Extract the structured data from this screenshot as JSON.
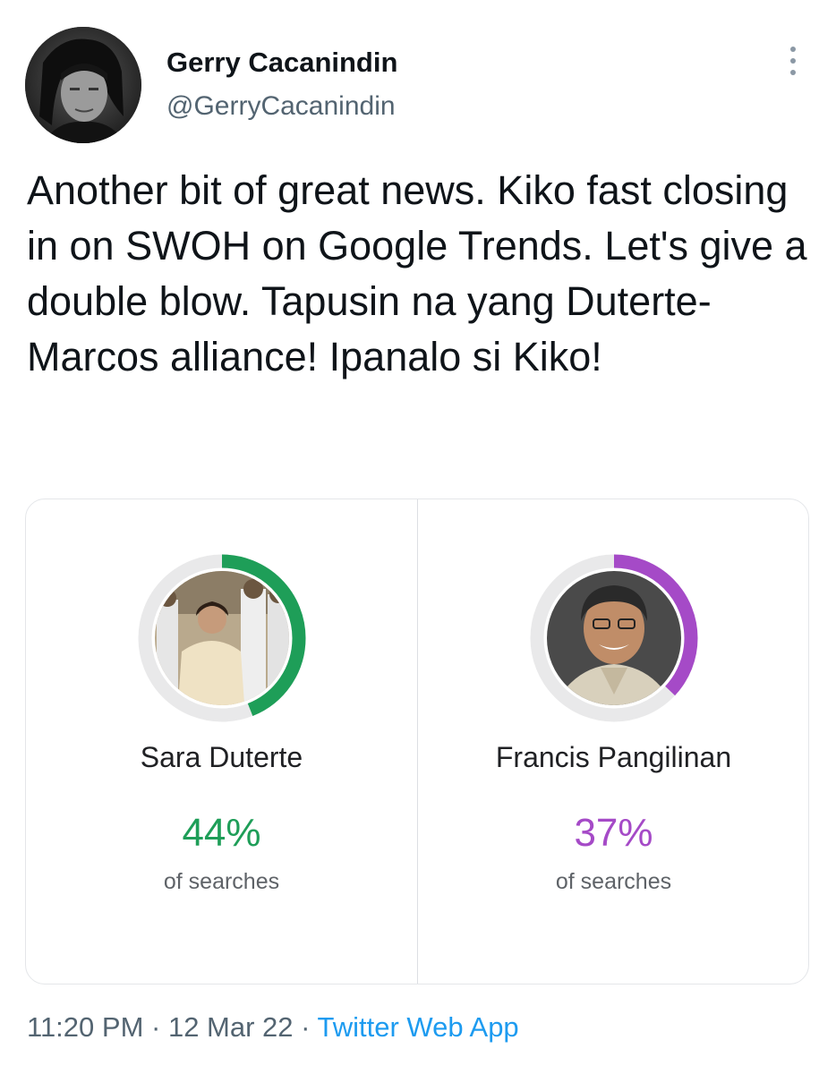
{
  "tweet": {
    "author": {
      "name": "Gerry Cacanindin",
      "handle": "@GerryCacanindin"
    },
    "text": "Another bit of great news. Kiko fast closing in on SWOH on Google Trends. Let's give a double blow. Tapusin na yang Duterte-Marcos alliance! Ipanalo si Kiko!",
    "time": "11:20 PM",
    "separator": " · ",
    "date": "12 Mar 22",
    "source": "Twitter Web App"
  },
  "card": {
    "left": {
      "name": "Sara Duterte",
      "percent_label": "44%",
      "share": 0.44,
      "caption": "of searches",
      "color": "#1e9e58"
    },
    "right": {
      "name": "Francis Pangilinan",
      "percent_label": "37%",
      "share": 0.37,
      "caption": "of searches",
      "color": "#a54ac7"
    }
  },
  "colors": {
    "source_link": "#1d9bf0",
    "muted_text": "#536471"
  },
  "icons": {
    "more": "more-vertical-icon"
  }
}
